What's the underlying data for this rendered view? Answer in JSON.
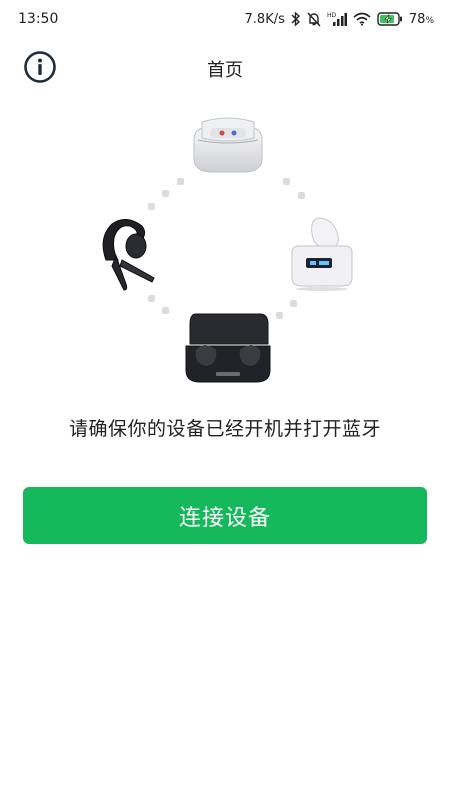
{
  "status_bar": {
    "time": "13:50",
    "net_speed": "7.8K/s",
    "battery_percent": "78",
    "battery_unit": "%",
    "icons": [
      "bluetooth-icon",
      "mute-icon",
      "hd-signal-icon",
      "wifi-icon",
      "battery-charging-icon"
    ]
  },
  "header": {
    "title": "首页",
    "info_icon": "info-icon"
  },
  "products": [
    {
      "name": "charging-case-white-top"
    },
    {
      "name": "earbud-case-white-right"
    },
    {
      "name": "earbuds-case-black-bottom"
    },
    {
      "name": "single-ear-headset-left"
    }
  ],
  "instruction": "请确保你的设备已经开机并打开蓝牙",
  "connect_button": {
    "label": "连接设备"
  },
  "colors": {
    "accent": "#16b85c",
    "text": "#222222",
    "dots": "#dcdcdc"
  }
}
